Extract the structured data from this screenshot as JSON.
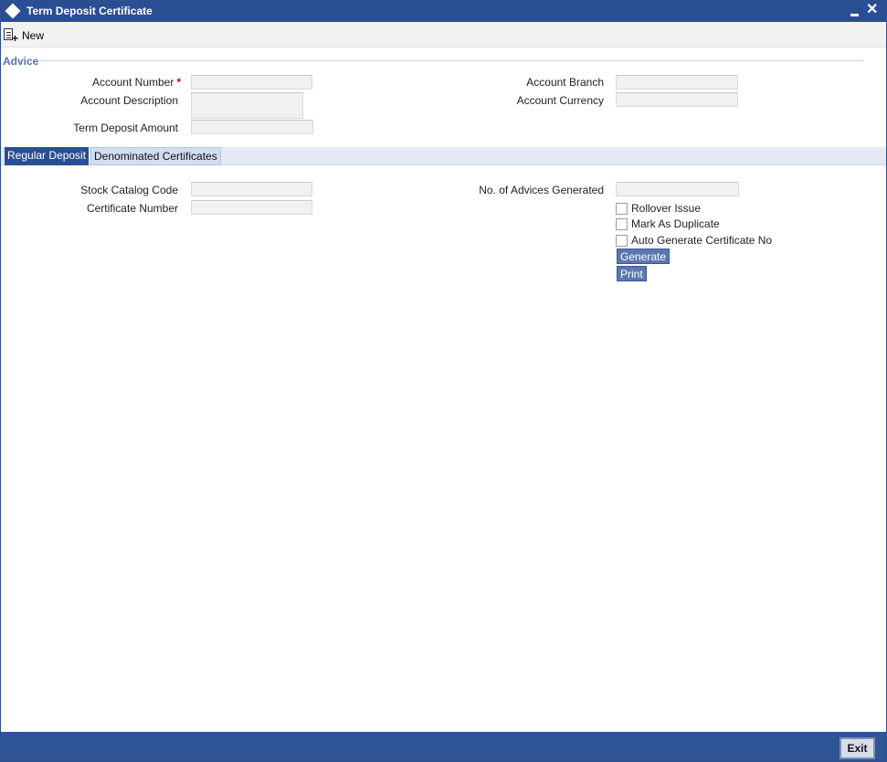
{
  "window": {
    "title": "Term Deposit Certificate",
    "minimize_icon": "minimize-icon",
    "close_icon": "close-icon"
  },
  "toolbar": {
    "new_label": "New",
    "new_icon": "new-document-icon"
  },
  "advice": {
    "legend": "Advice",
    "account_number_label": "Account Number",
    "account_number_required": "*",
    "account_number_value": "",
    "account_description_label": "Account Description",
    "account_description_value": "",
    "term_deposit_amount_label": "Term Deposit Amount",
    "term_deposit_amount_value": "",
    "account_branch_label": "Account Branch",
    "account_branch_value": "",
    "account_currency_label": "Account Currency",
    "account_currency_value": ""
  },
  "tabs": [
    {
      "label": "Regular Deposit",
      "active": true
    },
    {
      "label": "Denominated Certificates",
      "active": false
    }
  ],
  "regular_deposit": {
    "stock_catalog_code_label": "Stock Catalog Code",
    "stock_catalog_code_value": "",
    "certificate_number_label": "Certificate Number",
    "certificate_number_value": "",
    "advices_generated_label": "No. of Advices Generated",
    "advices_generated_value": "",
    "rollover_issue_label": "Rollover Issue",
    "mark_as_duplicate_label": "Mark As Duplicate",
    "auto_generate_label": "Auto Generate Certificate No",
    "generate_button": "Generate",
    "print_button": "Print"
  },
  "footer": {
    "exit_button": "Exit"
  },
  "colors": {
    "titlebar": "#2a4e93",
    "footer": "#2f5597",
    "legend": "#5273b5",
    "required": "#dd0000"
  }
}
